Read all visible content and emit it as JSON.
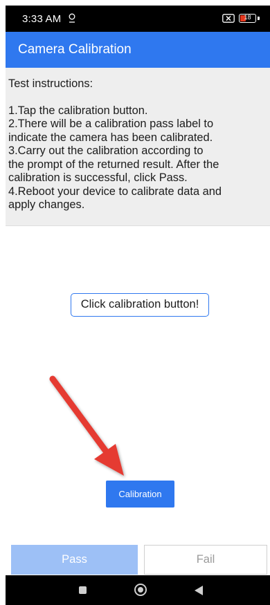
{
  "status_bar": {
    "time": "3:33 AM",
    "battery_level": "18",
    "battery_fraction": 0.18,
    "icons": [
      "location-icon",
      "battery-x-icon",
      "battery-icon"
    ]
  },
  "app_bar": {
    "title": "Camera Calibration"
  },
  "instructions": {
    "heading": "Test instructions:",
    "lines": [
      "1.Tap the calibration button.",
      "2.There will be a calibration pass label to",
      "indicate the camera has been calibrated.",
      "3.Carry out the calibration according to",
      "the prompt of the returned result. After the",
      "calibration is successful, click Pass.",
      "4.Reboot your device to calibrate data and",
      "apply changes."
    ]
  },
  "result_label": "Click calibration button!",
  "calibration_button": "Calibration",
  "pass_button": "Pass",
  "fail_button": "Fail",
  "nav_bar": {
    "icons": [
      "recents-icon",
      "home-icon",
      "back-icon"
    ]
  },
  "colors": {
    "accent": "#2f78ef",
    "pass_disabled": "#9dc0f6",
    "arrow": "#e53a33",
    "battery_low": "#e5381f"
  }
}
